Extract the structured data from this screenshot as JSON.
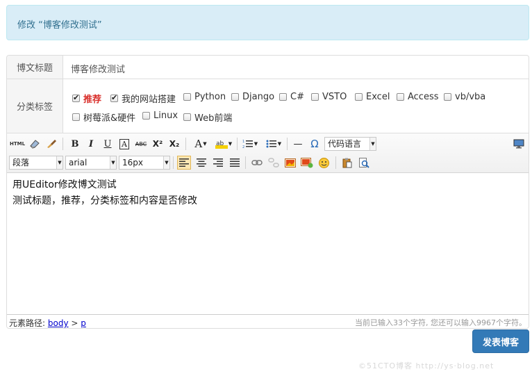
{
  "alert": {
    "text": "修改 “博客修改测试”"
  },
  "form": {
    "title_label": "博文标题",
    "title_value": "博客修改测试",
    "category_label": "分类标签",
    "categories": [
      {
        "label": "推荐",
        "checked": true
      },
      {
        "label": "我的网站搭建",
        "checked": true
      },
      {
        "label": "Python",
        "checked": false
      },
      {
        "label": "Django",
        "checked": false
      },
      {
        "label": "C#",
        "checked": false
      },
      {
        "label": "VSTO",
        "checked": false
      },
      {
        "label": "Excel",
        "checked": false
      },
      {
        "label": "Access",
        "checked": false
      },
      {
        "label": "vb/vba",
        "checked": false
      },
      {
        "label": "树莓派&硬件",
        "checked": false
      },
      {
        "label": "Linux",
        "checked": false
      },
      {
        "label": "Web前端",
        "checked": false
      }
    ]
  },
  "editor": {
    "toolbar": {
      "html_label": "HTML",
      "code_lang": "代码语言",
      "paragraph": "段落",
      "font_family": "arial",
      "font_size": "16px",
      "bold": "B",
      "italic": "I",
      "underline": "U",
      "font_border": "A",
      "strike": "ABC",
      "superscript": "X²",
      "subscript": "X₂",
      "font_color": "A",
      "omega": "Ω",
      "hr": "—"
    },
    "content_lines": [
      "用UEditor修改博文测试",
      "测试标题，推荐，分类标签和内容是否修改"
    ],
    "status": {
      "path_label": "元素路径:",
      "path_body": "body",
      "path_sep": ">",
      "path_p": "p",
      "char_count": "当前已输入33个字符, 您还可以输入9967个字符。"
    }
  },
  "submit_label": "发表博客",
  "watermark": "©51CTO博客 http://ys·blog.net"
}
